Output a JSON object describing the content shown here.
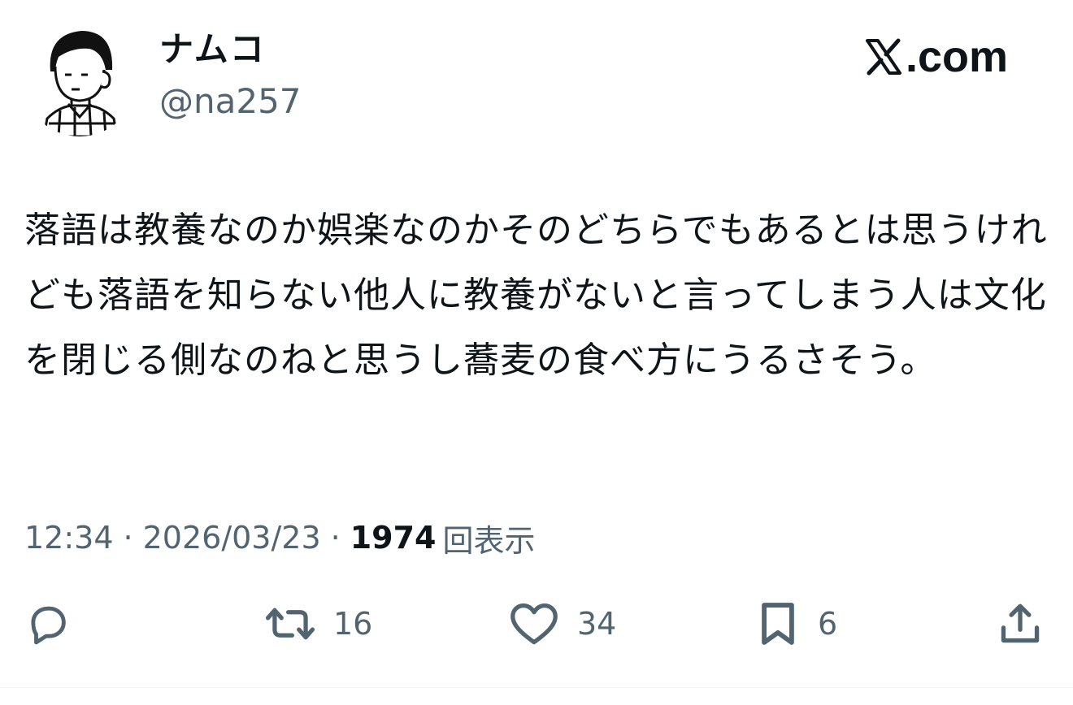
{
  "author": {
    "display_name": "ナムコ",
    "handle": "@na257",
    "avatar_icon": "avatar-illustration"
  },
  "watermark": {
    "text": ".com",
    "logo_icon": "x-logo-icon"
  },
  "tweet": {
    "text": "落語は教養なのか娯楽なのかそのどちらでもあるとは思うけれども落語を知らない他人に教養がないと言ってしまう人は文化を閉じる側なのねと思うし蕎麦の食べ方にうるさそう。",
    "time": "12:34",
    "separator": "·",
    "date": "2026/03/23",
    "views_count": "1974",
    "views_label": "回表示"
  },
  "actions": {
    "reply": {
      "icon": "reply-icon",
      "count": ""
    },
    "repost": {
      "icon": "repost-icon",
      "count": "16"
    },
    "like": {
      "icon": "heart-icon",
      "count": "34"
    },
    "bookmark": {
      "icon": "bookmark-icon",
      "count": "6"
    },
    "share": {
      "icon": "share-icon"
    }
  },
  "colors": {
    "text_primary": "#0f1419",
    "text_secondary": "#536471",
    "icon": "#536471",
    "background": "#ffffff"
  }
}
